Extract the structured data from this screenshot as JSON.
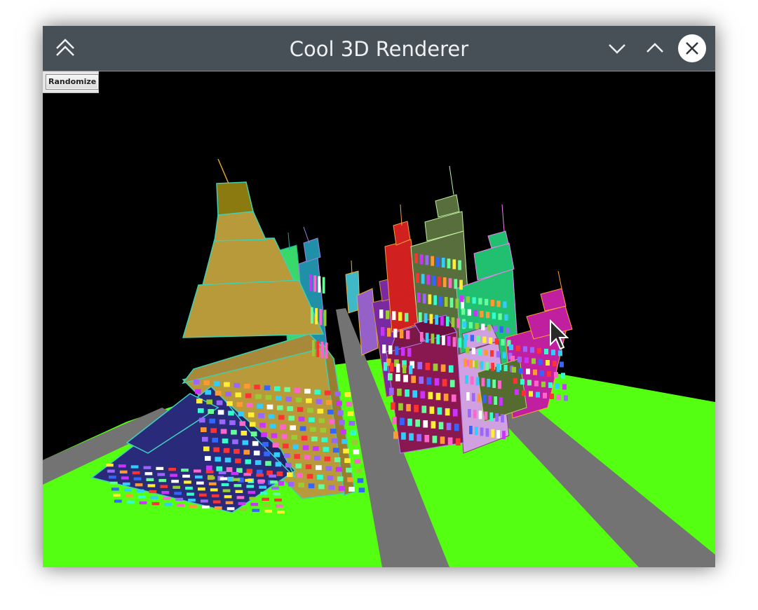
{
  "window": {
    "title": "Cool 3D Renderer",
    "buttons": {
      "keep_above": "keep-above-icon",
      "minimize": "chevron-down-icon",
      "maximize": "chevron-up-icon",
      "close": "close-icon"
    }
  },
  "toolbar": {
    "randomize_label": "Randomize"
  },
  "colors": {
    "titlebar": "#475057",
    "accent": "#3daee9",
    "ground": "#55ff11",
    "road": "#737373",
    "sky": "#000000"
  }
}
